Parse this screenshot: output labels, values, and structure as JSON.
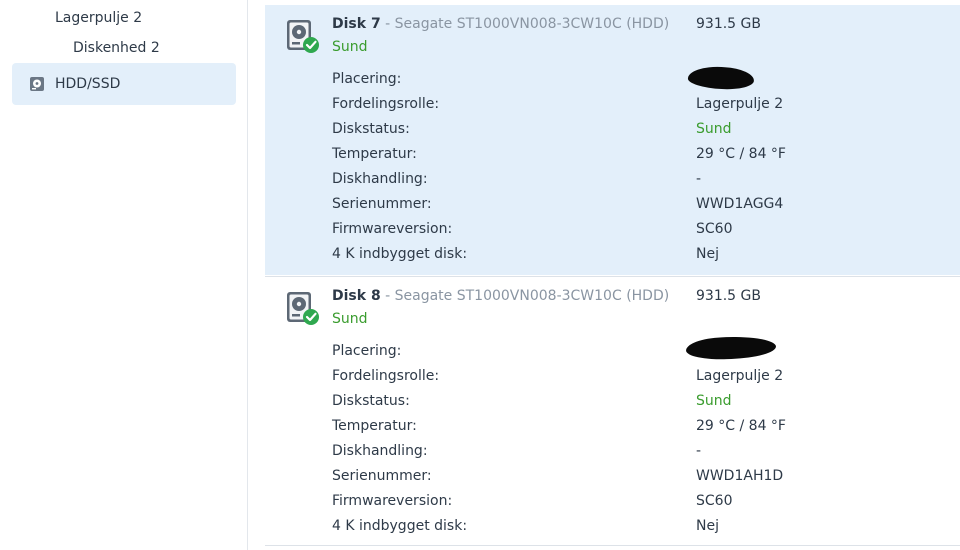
{
  "sidebar": {
    "tree": [
      {
        "label": "Lagerpulje 2"
      },
      {
        "label": "Diskenhed 2"
      }
    ],
    "selected": {
      "label": "HDD/SSD",
      "icon": "hdd-icon"
    }
  },
  "labels": {
    "location": "Placering:",
    "role": "Fordelingsrolle:",
    "status": "Diskstatus:",
    "temperature": "Temperatur:",
    "action": "Diskhandling:",
    "serial": "Serienummer:",
    "firmware": "Firmwareversion:",
    "native4k": "4 K indbygget disk:"
  },
  "colors": {
    "accent_selected": "#e3effa",
    "healthy": "#3a9c2e",
    "muted": "#8a95a2"
  },
  "disks": [
    {
      "name": "Disk 7",
      "model": " - Seagate ST1000VN008-3CW10C (HDD)",
      "size": "931.5 GB",
      "health": "Sund",
      "location": "",
      "role": "Lagerpulje 2",
      "status": "Sund",
      "temperature": "29 °C / 84 °F",
      "action": "-",
      "serial": "WWD1AGG4",
      "firmware": "SC60",
      "native4k": "Nej"
    },
    {
      "name": "Disk 8",
      "model": " - Seagate ST1000VN008-3CW10C (HDD)",
      "size": "931.5 GB",
      "health": "Sund",
      "location": "",
      "role": "Lagerpulje 2",
      "status": "Sund",
      "temperature": "29 °C / 84 °F",
      "action": "-",
      "serial": "WWD1AH1D",
      "firmware": "SC60",
      "native4k": "Nej"
    }
  ]
}
